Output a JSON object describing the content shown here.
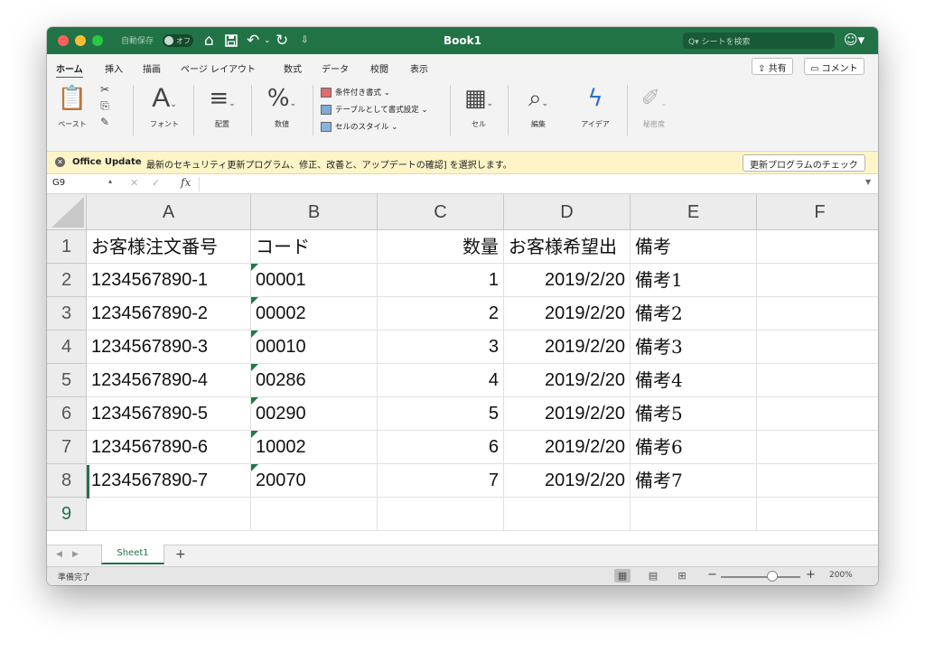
{
  "titlebar": {
    "title": "Book1",
    "autosave_label": "自動保存",
    "autosave_state": "オフ",
    "search_placeholder": "シートを検索",
    "icons": [
      "home-icon",
      "save-icon",
      "undo-icon",
      "redo-icon",
      "customize-toolbar-icon",
      "user-icon"
    ]
  },
  "menu": {
    "tabs": [
      "ホーム",
      "挿入",
      "描画",
      "ページ レイアウト",
      "数式",
      "データ",
      "校閲",
      "表示"
    ],
    "active": "ホーム",
    "share": "共有",
    "comment": "コメント"
  },
  "ribbon": {
    "paste": "ペースト",
    "font": "フォント",
    "align": "配置",
    "number": "数値",
    "conditional": "条件付き書式",
    "table": "テーブルとして書式設定",
    "cellstyle": "セルのスタイル",
    "cells": "セル",
    "edit": "編集",
    "ideas": "アイデア",
    "sensitivity": "秘密度"
  },
  "notify": {
    "head": "Office Update",
    "msg": "最新のセキュリティ更新プログラム、修正、改善と、アップデートの確認] を選択します。",
    "button": "更新プログラムのチェック"
  },
  "formula": {
    "name": "G9",
    "fx": "fx",
    "value": ""
  },
  "columns": [
    "A",
    "B",
    "C",
    "D",
    "E",
    "F"
  ],
  "row_numbers": [
    "1",
    "2",
    "3",
    "4",
    "5",
    "6",
    "7",
    "8",
    "9"
  ],
  "rows": [
    [
      "お客様注文番号",
      "コード",
      "数量",
      "お客様希望出",
      "備考",
      ""
    ],
    [
      "1234567890-1",
      "00001",
      "1",
      "2019/2/20",
      "備考1",
      ""
    ],
    [
      "1234567890-2",
      "00002",
      "2",
      "2019/2/20",
      "備考2",
      ""
    ],
    [
      "1234567890-3",
      "00010",
      "3",
      "2019/2/20",
      "備考3",
      ""
    ],
    [
      "1234567890-4",
      "00286",
      "4",
      "2019/2/20",
      "備考4",
      ""
    ],
    [
      "1234567890-5",
      "00290",
      "5",
      "2019/2/20",
      "備考5",
      ""
    ],
    [
      "1234567890-6",
      "10002",
      "6",
      "2019/2/20",
      "備考6",
      ""
    ],
    [
      "1234567890-7",
      "20070",
      "7",
      "2019/2/20",
      "備考7",
      ""
    ],
    [
      "",
      "",
      "",
      "",
      "",
      ""
    ]
  ],
  "sheet": {
    "tab": "Sheet1",
    "add": "+"
  },
  "status": {
    "text": "準備完了",
    "zoom": "200%"
  },
  "colors": {
    "accent": "#217346",
    "warning_bg": "#fdf4c7"
  }
}
